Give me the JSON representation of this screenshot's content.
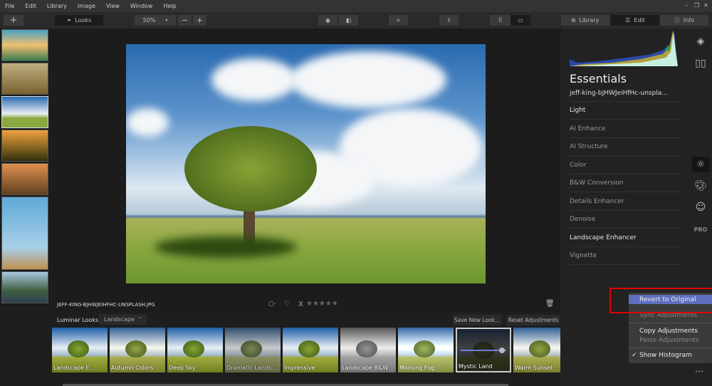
{
  "menu": [
    "File",
    "Edit",
    "Library",
    "Image",
    "View",
    "Window",
    "Help"
  ],
  "window_controls": {
    "minimize": "–",
    "restore": "❐",
    "close": "✕"
  },
  "toolbar": {
    "add": "+",
    "looks": "Looks",
    "zoom": "50%",
    "zoom_out": "−",
    "zoom_in": "+",
    "tabs": [
      "Library",
      "Edit",
      "Info"
    ],
    "active_tab": "Edit"
  },
  "image": {
    "filename": "JEFF-KING-BJHWJEIHFHC-UNSPLASH.JPG",
    "rating_stars": "★★★★★",
    "reject": "X",
    "flag": "○·",
    "heart": "♡"
  },
  "looks": {
    "label": "Luminar Looks:",
    "category": "Landscape",
    "save": "Save New Look...",
    "reset": "Reset Adjustments",
    "items": [
      "Landscape E...",
      "Autumn Colors",
      "Deep Sky",
      "Dramatic Lands...",
      "Impressive",
      "Landscape B&W",
      "Morning Fog",
      "Mystic Land",
      "Warm Sunset"
    ],
    "selected": "Mystic Land",
    "selected_amount": 0.9
  },
  "panel": {
    "title": "Essentials",
    "filename": "jeff-king-bJHWJeiHfHc-unspla...",
    "items": [
      {
        "label": "Light",
        "active": true
      },
      {
        "label": "AI Enhance",
        "active": false
      },
      {
        "label": "AI Structure",
        "active": false
      },
      {
        "label": "Color",
        "active": false
      },
      {
        "label": "B&W Conversion",
        "active": false
      },
      {
        "label": "Details Enhancer",
        "active": false
      },
      {
        "label": "Denoise",
        "active": false
      },
      {
        "label": "Landscape Enhancer",
        "active": true
      },
      {
        "label": "Vignette",
        "active": false
      }
    ],
    "pro": "PRO",
    "more": "•••"
  },
  "popup": {
    "revert": "Revert to Original",
    "sync": "Sync Adjustments",
    "copy": "Copy Adjustments",
    "paste": "Paste Adjustments",
    "histogram": "Show Histogram",
    "check": "✓"
  },
  "colors": {
    "accent": "#5f6fbf",
    "highlight_box": "#e00000",
    "bg": "#1e1e1e"
  }
}
